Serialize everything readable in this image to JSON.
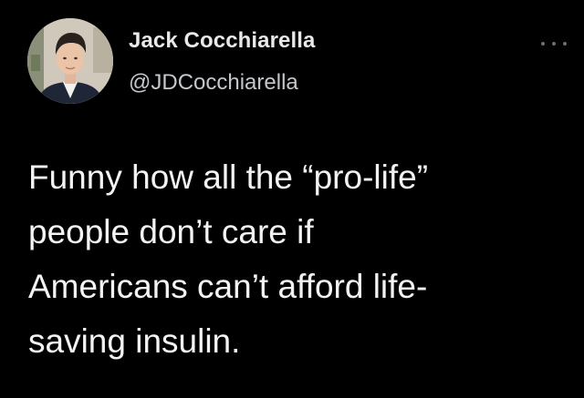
{
  "author": {
    "display_name": "Jack Cocchiarella",
    "handle": "@JDCocchiarella",
    "avatar_icon": "profile-photo"
  },
  "tweet": {
    "text_lines": [
      "Funny how all the “pro-life”",
      "people don’t care if",
      "Americans can’t afford life-",
      "saving insulin."
    ]
  },
  "actions": {
    "more_icon": "more-options-icon"
  },
  "colors": {
    "background": "#000000",
    "text_primary": "#e7e9ea",
    "text_secondary": "#c4c8cc"
  }
}
